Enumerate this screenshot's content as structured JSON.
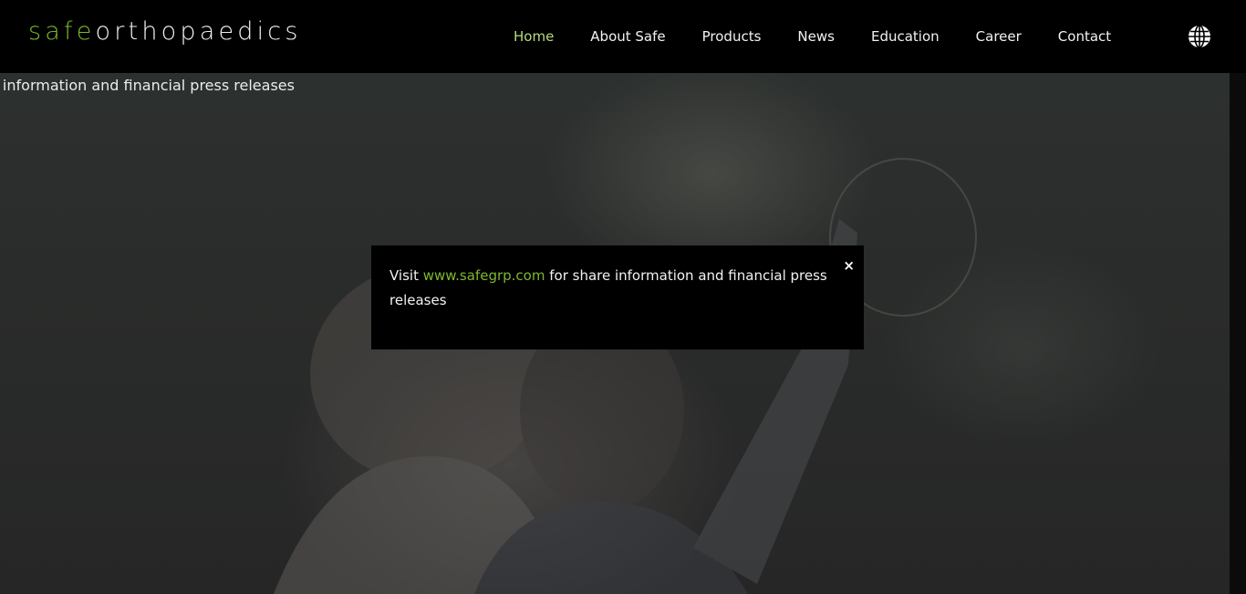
{
  "logo": {
    "part1": "safe",
    "part2": "orthopaedics"
  },
  "nav": {
    "items": [
      {
        "label": "Home",
        "active": true
      },
      {
        "label": "About Safe"
      },
      {
        "label": "Products"
      },
      {
        "label": "News"
      },
      {
        "label": "Education"
      },
      {
        "label": "Career"
      },
      {
        "label": "Contact"
      }
    ],
    "language_icon": "globe-icon"
  },
  "marquee": {
    "text": "e information and financial press releases"
  },
  "modal": {
    "prefix": "Visit ",
    "link": "www.safegrp.com",
    "suffix": " for share information and financial press releases",
    "close": "×"
  },
  "colors": {
    "brand_green": "#7cb82f",
    "active_nav": "#b7dc7e",
    "background": "#000000"
  }
}
